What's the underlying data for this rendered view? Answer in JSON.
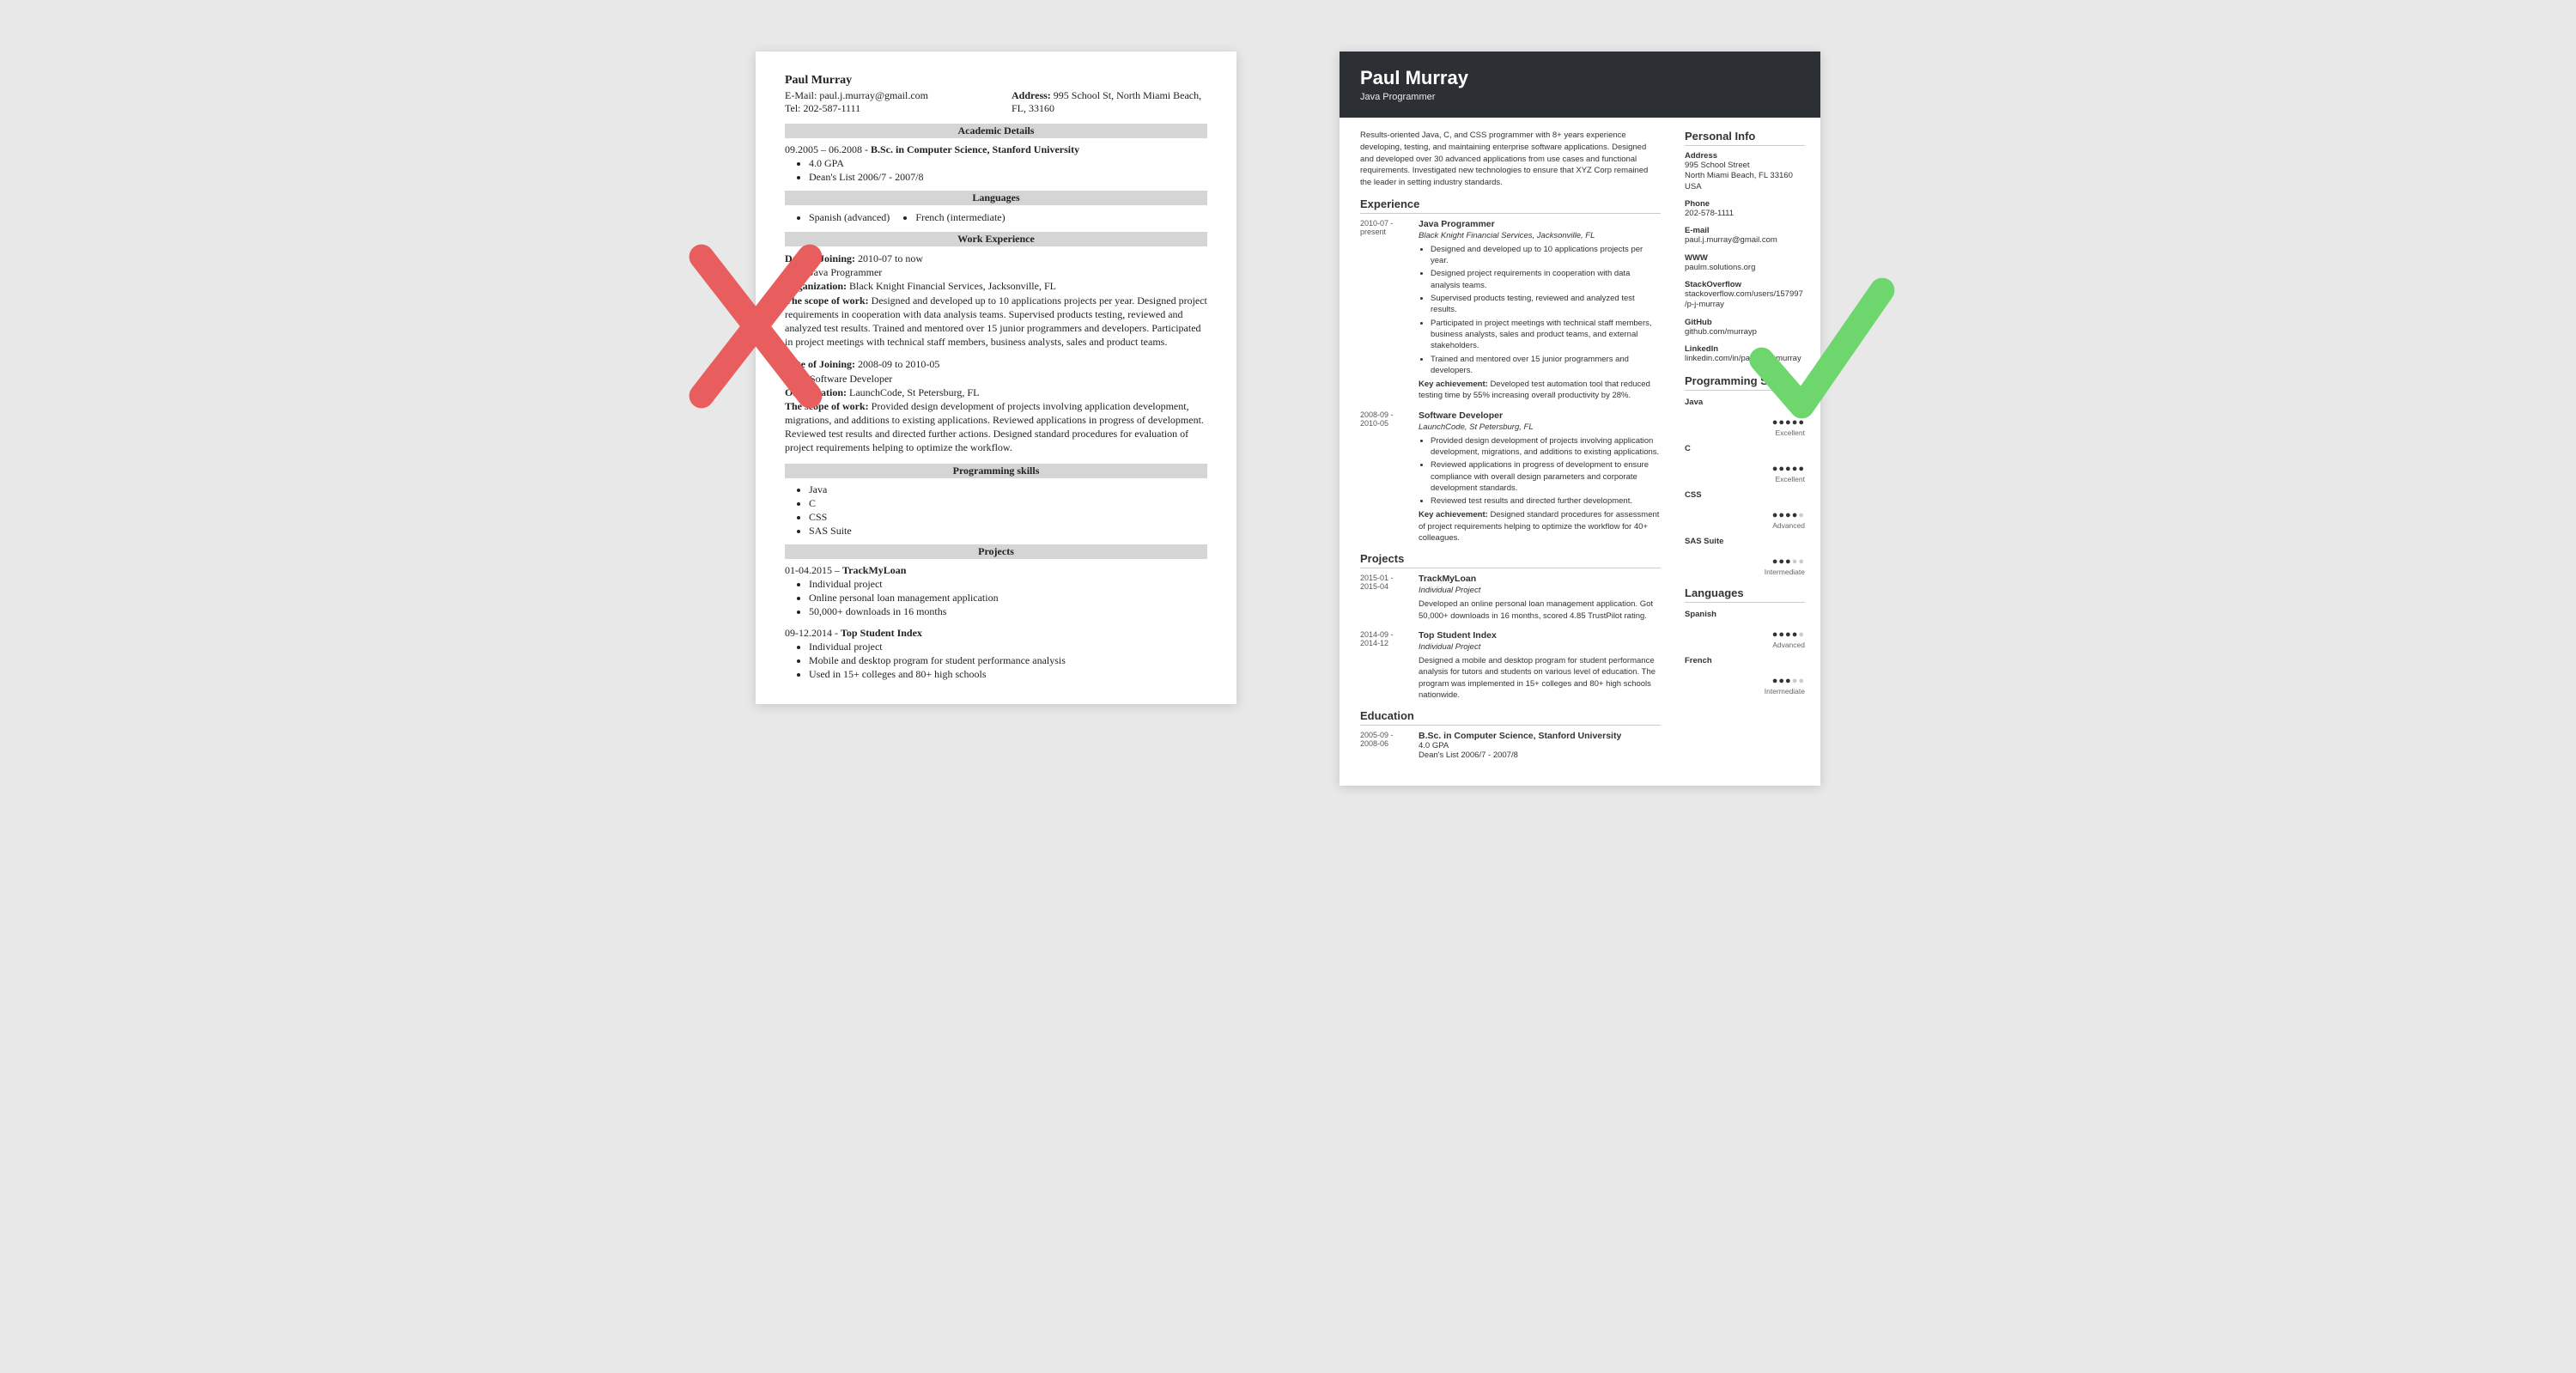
{
  "left": {
    "name": "Paul Murray",
    "email_label": "E-Mail:",
    "email": "paul.j.murray@gmail.com",
    "tel_label": "Tel:",
    "tel": "202-587-1111",
    "addr_label": "Address:",
    "addr": "995 School St, North Miami Beach, FL, 33160",
    "sec_academic": "Academic Details",
    "edu_line": "09.2005 – 06.2008 - B.Sc. in Computer Science, Stanford University",
    "edu_bullets": [
      "4.0 GPA",
      "Dean's List 2006/7 - 2007/8"
    ],
    "sec_languages": "Languages",
    "lang1": "Spanish (advanced)",
    "lang2": "French (intermediate)",
    "sec_work": "Work Experience",
    "job1": {
      "doj_label": "Date of Joining:",
      "doj": "2010-07 to now",
      "post_label": "Post:",
      "post": "Java Programmer",
      "org_label": "Organization:",
      "org": "Black Knight Financial Services, Jacksonville, FL",
      "scope_label": "The scope of work:",
      "scope": "Designed and developed up to 10 applications projects per year. Designed project requirements in cooperation with data analysis teams. Supervised products testing, reviewed and analyzed test results. Trained and mentored over 15 junior programmers and developers. Participated in project meetings with technical staff members, business analysts, sales and product teams."
    },
    "job2": {
      "doj_label": "Date of Joining:",
      "doj": "2008-09 to 2010-05",
      "post_label": "Post:",
      "post": "Software Developer",
      "org_label": "Organization:",
      "org": "LaunchCode, St Petersburg, FL",
      "scope_label": "The scope of work:",
      "scope": "Provided design development of projects involving application development, migrations, and additions to existing applications. Reviewed applications in progress of development. Reviewed test results and directed further actions. Designed standard procedures for evaluation of project requirements helping to optimize the workflow."
    },
    "sec_skills": "Programming skills",
    "skills": [
      "Java",
      "C",
      "CSS",
      "SAS Suite"
    ],
    "sec_projects": "Projects",
    "proj1_head": "01-04.2015 – TrackMyLoan",
    "proj1_bullets": [
      "Individual project",
      "Online personal loan management application",
      "50,000+ downloads in 16 months"
    ],
    "proj2_head": "09-12.2014 - Top Student Index",
    "proj2_bullets": [
      "Individual project",
      "Mobile and desktop program for student performance analysis",
      "Used in 15+ colleges and 80+ high schools"
    ]
  },
  "right": {
    "name": "Paul Murray",
    "title": "Java Programmer",
    "summary": "Results-oriented Java, C, and CSS programmer with 8+ years experience developing, testing, and maintaining enterprise software applications. Designed and developed over 30 advanced applications from use cases and functional requirements. Investigated new technologies to ensure that XYZ Corp remained the leader in setting industry standards.",
    "sec_exp": "Experience",
    "exp1": {
      "date": "2010-07 - present",
      "title": "Java Programmer",
      "sub": "Black Knight Financial Services, Jacksonville, FL",
      "bullets": [
        "Designed and developed up to 10 applications projects per year.",
        "Designed project requirements in cooperation with data analysis teams.",
        "Supervised products testing, reviewed and analyzed test results.",
        "Participated in project meetings with technical staff members, business analysts, sales and product teams, and external stakeholders.",
        "Trained and mentored over 15 junior programmers and developers."
      ],
      "key_label": "Key achievement:",
      "key": "Developed test automation tool that reduced testing time by 55% increasing overall productivity by 28%."
    },
    "exp2": {
      "date": "2008-09 - 2010-05",
      "title": "Software Developer",
      "sub": "LaunchCode, St Petersburg, FL",
      "bullets": [
        "Provided design development of projects involving application development, migrations, and additions to existing applications.",
        "Reviewed applications in progress of development to ensure compliance with overall design parameters and corporate development standards.",
        "Reviewed test results and directed further development."
      ],
      "key_label": "Key achievement:",
      "key": "Designed standard procedures for assessment of project requirements helping to optimize the workflow for 40+ colleagues."
    },
    "sec_projects": "Projects",
    "proj1": {
      "date": "2015-01 - 2015-04",
      "title": "TrackMyLoan",
      "sub": "Individual Project",
      "desc": "Developed an online personal loan management application. Got 50,000+ downloads in 16 months, scored 4.85 TrustPilot rating."
    },
    "proj2": {
      "date": "2014-09 - 2014-12",
      "title": "Top Student Index",
      "sub": "Individual Project",
      "desc": "Designed a mobile and desktop program for student performance analysis for tutors and students on various level of education. The program was implemented in 15+ colleges and 80+ high schools nationwide."
    },
    "sec_edu": "Education",
    "edu": {
      "date": "2005-09 - 2008-06",
      "title": "B.Sc. in Computer Science, Stanford University",
      "l1": "4.0 GPA",
      "l2": "Dean's List 2006/7 - 2007/8"
    },
    "side_info_h": "Personal Info",
    "info": {
      "addr_l": "Address",
      "addr_v": "995 School Street\nNorth Miami Beach, FL 33160\nUSA",
      "phone_l": "Phone",
      "phone_v": "202-578-1111",
      "email_l": "E-mail",
      "email_v": "paul.j.murray@gmail.com",
      "www_l": "WWW",
      "www_v": "paulm.solutions.org",
      "so_l": "StackOverflow",
      "so_v": "stackoverflow.com/users/157997/p-j-murray",
      "gh_l": "GitHub",
      "gh_v": "github.com/murrayp",
      "li_l": "LinkedIn",
      "li_v": "linkedin.com/in/pauljamiemurray"
    },
    "side_skills_h": "Programming Skills",
    "skills": [
      {
        "name": "Java",
        "level": "Excellent",
        "filled": 5
      },
      {
        "name": "C",
        "level": "Excellent",
        "filled": 5
      },
      {
        "name": "CSS",
        "level": "Advanced",
        "filled": 4
      },
      {
        "name": "SAS Suite",
        "level": "Intermediate",
        "filled": 3
      }
    ],
    "side_lang_h": "Languages",
    "langs": [
      {
        "name": "Spanish",
        "level": "Advanced",
        "filled": 4
      },
      {
        "name": "French",
        "level": "Intermediate",
        "filled": 3
      }
    ]
  }
}
